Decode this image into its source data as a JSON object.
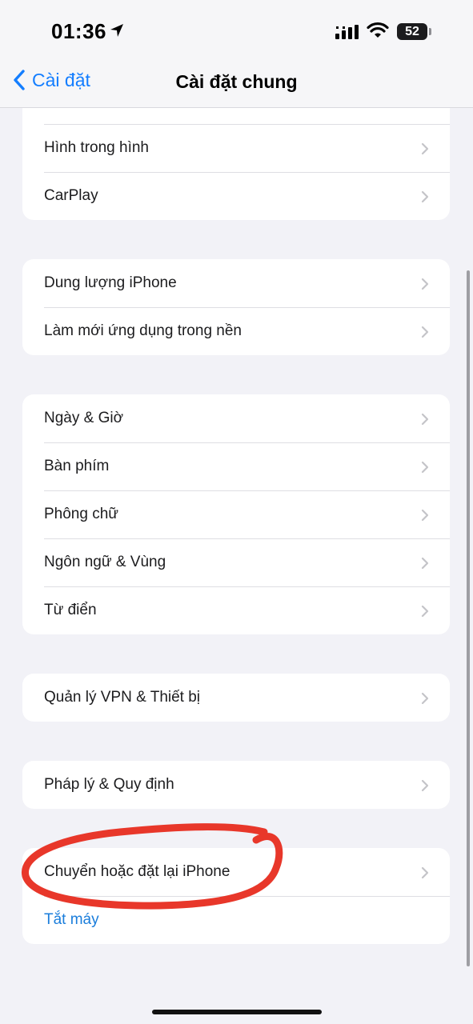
{
  "status_bar": {
    "time": "01:36",
    "battery": "52",
    "icons": [
      "location-arrow-icon",
      "cellular-signal-icon",
      "wifi-icon",
      "battery-icon"
    ]
  },
  "nav": {
    "back_label": "Cài đặt",
    "title": "Cài đặt chung"
  },
  "groups": [
    {
      "rows": [
        {
          "label": ""
        },
        {
          "label": "Hình trong hình"
        },
        {
          "label": "CarPlay"
        }
      ]
    },
    {
      "rows": [
        {
          "label": "Dung lượng iPhone"
        },
        {
          "label": "Làm mới ứng dụng trong nền"
        }
      ]
    },
    {
      "rows": [
        {
          "label": "Ngày & Giờ"
        },
        {
          "label": "Bàn phím"
        },
        {
          "label": "Phông chữ"
        },
        {
          "label": "Ngôn ngữ & Vùng"
        },
        {
          "label": "Từ điển"
        }
      ]
    },
    {
      "rows": [
        {
          "label": "Quản lý VPN & Thiết bị"
        }
      ]
    },
    {
      "rows": [
        {
          "label": "Pháp lý & Quy định"
        }
      ]
    },
    {
      "rows": [
        {
          "label": "Chuyển hoặc đặt lại iPhone"
        },
        {
          "label": "Tắt máy"
        }
      ]
    }
  ],
  "colors": {
    "accent": "#147eff",
    "annotation": "#e8372a",
    "background": "#f2f2f7"
  }
}
